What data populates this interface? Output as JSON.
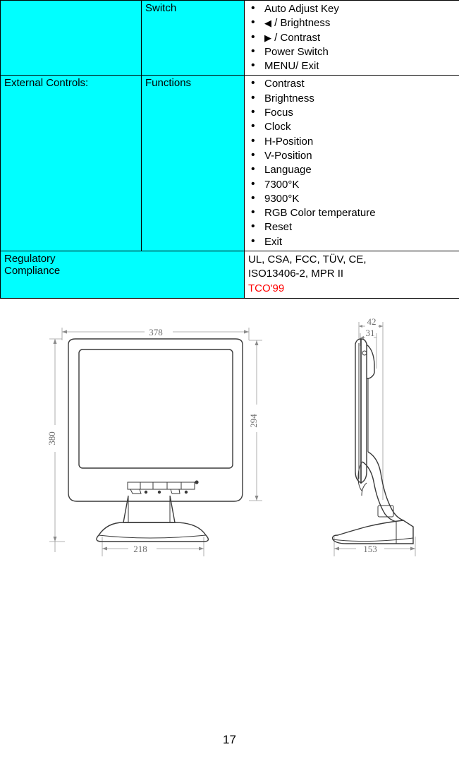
{
  "spec_table": {
    "rows": [
      {
        "id": "switch-row",
        "label": "",
        "subcategory": "Switch",
        "items": [
          {
            "text": "Auto Adjust Key",
            "glyph": ""
          },
          {
            "text": "/ Brightness",
            "glyph": "◀"
          },
          {
            "text": "/ Contrast",
            "glyph": "▶"
          },
          {
            "text": "Power Switch",
            "glyph": ""
          },
          {
            "text": "MENU/ Exit",
            "glyph": ""
          }
        ]
      },
      {
        "id": "functions-row",
        "label": "External Controls:",
        "subcategory": "Functions",
        "items": [
          {
            "text": "Contrast",
            "glyph": ""
          },
          {
            "text": "Brightness",
            "glyph": ""
          },
          {
            "text": "Focus",
            "glyph": ""
          },
          {
            "text": "Clock",
            "glyph": ""
          },
          {
            "text": "H-Position",
            "glyph": ""
          },
          {
            "text": "V-Position",
            "glyph": ""
          },
          {
            "text": "Language",
            "glyph": ""
          },
          {
            "text": "7300°K",
            "glyph": ""
          },
          {
            "text": "9300°K",
            "glyph": ""
          },
          {
            "text": "RGB Color temperature",
            "glyph": ""
          },
          {
            "text": "Reset",
            "glyph": ""
          },
          {
            "text": "Exit",
            "glyph": ""
          }
        ]
      }
    ],
    "regulatory": {
      "label": "Regulatory\nCompliance",
      "line1": "UL, CSA, FCC, TÜV, CE,",
      "line2": "ISO13406-2, MPR II",
      "line3": "TCO'99",
      "line3_color": "#ff0000"
    },
    "cell_fill_color": "#00ffff",
    "border_color": "#000000"
  },
  "drawings": {
    "front_view": {
      "name": "monitor-front-view",
      "dimensions": {
        "width_overall": "378",
        "height_overall": "380",
        "panel_height": "294",
        "base_width": "218"
      }
    },
    "side_view": {
      "name": "monitor-side-view",
      "dimensions": {
        "depth_top": "42",
        "depth_inner": "31",
        "base_depth": "153"
      }
    }
  },
  "footer": {
    "page_number": "17"
  }
}
